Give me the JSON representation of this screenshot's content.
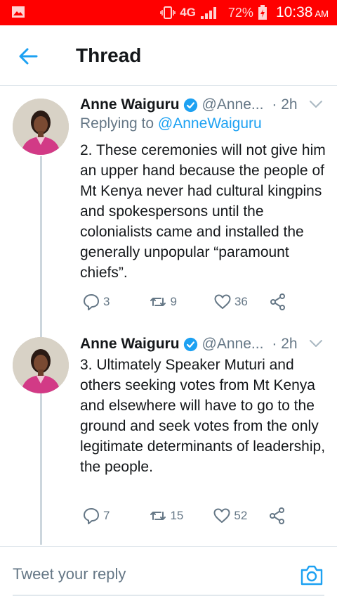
{
  "status_bar": {
    "network": "4G",
    "battery_percent": "72%",
    "time": "10:38",
    "am_pm": "AM",
    "background": "#ff0000",
    "icons": [
      "gallery-icon",
      "vibrate-icon",
      "signal-icon",
      "battery-icon"
    ]
  },
  "header": {
    "title": "Thread",
    "back_icon": "arrow-left-icon",
    "accent": "#1da1f2"
  },
  "tweets": [
    {
      "name": "Anne Waiguru",
      "handle": "@Anne...",
      "time": "· 2h",
      "replying_prefix": "Replying to",
      "replying_handle": "@AnneWaiguru",
      "text": "2. These ceremonies will not give him an upper hand because the people of Mt Kenya never had cultural kingpins and spokespersons until the colonialists came and installed the generally unpopular “paramount chiefs”.",
      "replies": "3",
      "retweets": "9",
      "likes": "36"
    },
    {
      "name": "Anne Waiguru",
      "handle": "@Anne...",
      "time": "· 2h",
      "text": "3. Ultimately Speaker Muturi and others seeking votes from Mt Kenya and elsewhere will have to go to the ground and seek votes from the only legitimate determinants of leadership, the people.",
      "replies": "7",
      "retweets": "15",
      "likes": "52"
    }
  ],
  "reply": {
    "placeholder": "Tweet your reply",
    "camera_icon": "camera-icon"
  }
}
